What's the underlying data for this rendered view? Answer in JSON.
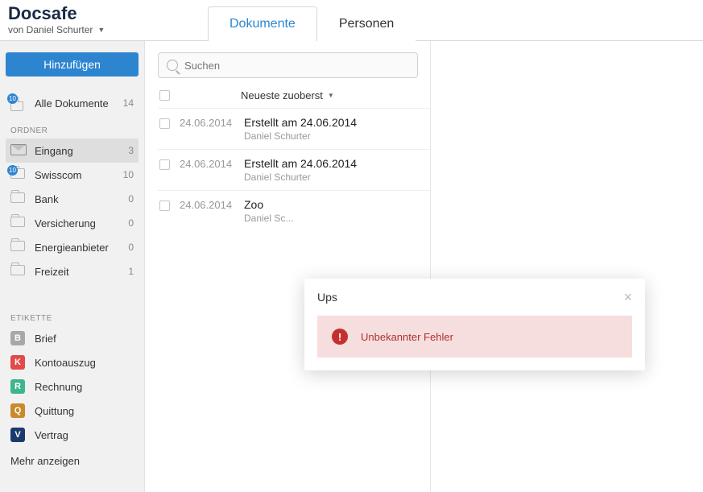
{
  "brand": {
    "title": "Docsafe",
    "subtitle": "von Daniel Schurter"
  },
  "tabs": {
    "documents": "Dokumente",
    "persons": "Personen"
  },
  "sidebar": {
    "add_button": "Hinzufügen",
    "all": {
      "label": "Alle Dokumente",
      "count": "14",
      "badge": "10"
    },
    "folders_title": "ORDNER",
    "folders": [
      {
        "label": "Eingang",
        "count": "3",
        "icon": "inbox",
        "active": true
      },
      {
        "label": "Swisscom",
        "count": "10",
        "icon": "folder",
        "badge": "10"
      },
      {
        "label": "Bank",
        "count": "0",
        "icon": "folder"
      },
      {
        "label": "Versicherung",
        "count": "0",
        "icon": "folder"
      },
      {
        "label": "Energieanbieter",
        "count": "0",
        "icon": "folder"
      },
      {
        "label": "Freizeit",
        "count": "1",
        "icon": "folder"
      }
    ],
    "tags_title": "ETIKETTE",
    "tags": [
      {
        "letter": "B",
        "label": "Brief",
        "color": "#a8a8a8"
      },
      {
        "letter": "K",
        "label": "Kontoauszug",
        "color": "#e24a4a"
      },
      {
        "letter": "R",
        "label": "Rechnung",
        "color": "#3fb58f"
      },
      {
        "letter": "Q",
        "label": "Quittung",
        "color": "#c98a2c"
      },
      {
        "letter": "V",
        "label": "Vertrag",
        "color": "#1a3a6e"
      }
    ],
    "more": "Mehr anzeigen"
  },
  "search": {
    "placeholder": "Suchen"
  },
  "sort": {
    "label": "Neueste zuoberst"
  },
  "documents": [
    {
      "date": "24.06.2014",
      "title": "Erstellt am 24.06.2014",
      "author": "Daniel Schurter"
    },
    {
      "date": "24.06.2014",
      "title": "Erstellt am 24.06.2014",
      "author": "Daniel Schurter"
    },
    {
      "date": "24.06.2014",
      "title": "Zoo",
      "author": "Daniel Sc..."
    }
  ],
  "modal": {
    "title": "Ups",
    "message": "Unbekannter Fehler"
  }
}
